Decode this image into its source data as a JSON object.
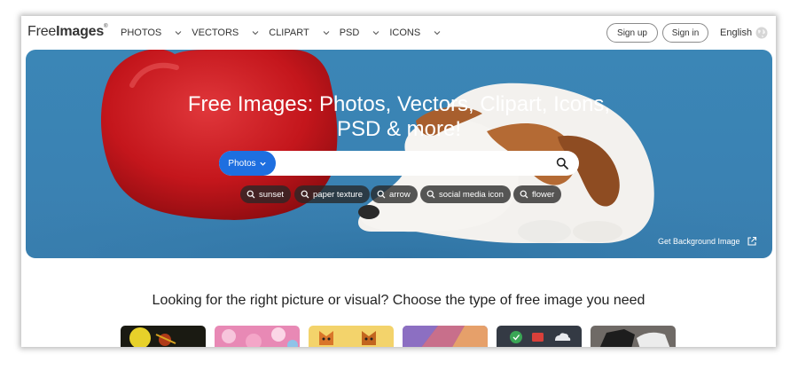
{
  "header": {
    "logo_light": "Free",
    "logo_bold": "Images",
    "logo_mark": "®",
    "nav": [
      {
        "label": "PHOTOS"
      },
      {
        "label": "VECTORS"
      },
      {
        "label": "CLIPART"
      },
      {
        "label": "PSD"
      },
      {
        "label": "ICONS"
      }
    ],
    "signup_label": "Sign up",
    "signin_label": "Sign in",
    "language": "English"
  },
  "hero": {
    "title_line1": "Free Images: Photos, Vectors, Clipart, Icons,",
    "title_line2": "PSD & more!",
    "search": {
      "type_label": "Photos",
      "value": "",
      "placeholder": ""
    },
    "tags": [
      "sunset",
      "paper texture",
      "arrow",
      "social media icon",
      "flower"
    ],
    "background_link": "Get Background Image"
  },
  "section": {
    "title": "Looking for the right picture or visual? Choose the type of free image you need"
  },
  "colors": {
    "accent": "#1e6fe0",
    "hero_bg": "#3a82b3",
    "tag_bg": "#2b2b2b"
  }
}
